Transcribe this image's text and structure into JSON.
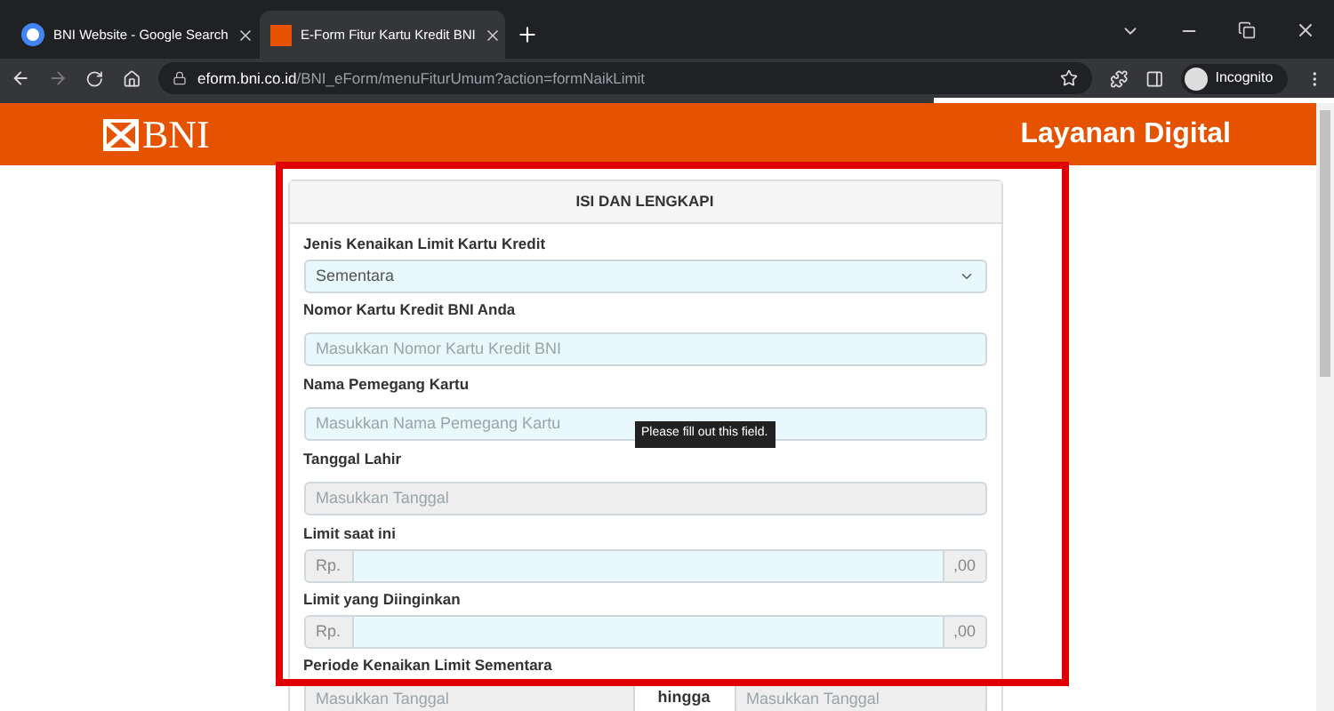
{
  "browser": {
    "tabs": [
      {
        "title": "BNI Website - Google Search",
        "selected": false
      },
      {
        "title": "E-Form Fitur Kartu Kredit BNI",
        "selected": true
      }
    ],
    "url_host": "eform.bni.co.id",
    "url_path": "/BNI_eForm/menuFiturUmum?action=formNaikLimit",
    "profile": "Incognito"
  },
  "header": {
    "logo": "BNI",
    "title": "Layanan Digital"
  },
  "form": {
    "title": "ISI DAN LENGKAPI",
    "fields": [
      {
        "kind": "select",
        "label": "Jenis Kenaikan Limit Kartu Kredit",
        "value": "Sementara"
      },
      {
        "kind": "text",
        "label": "Nomor Kartu Kredit BNI Anda",
        "placeholder": "Masukkan Nomor Kartu Kredit BNI",
        "disabled": false
      },
      {
        "kind": "text",
        "label": "Nama Pemegang Kartu",
        "placeholder": "Masukkan Nama Pemegang Kartu",
        "disabled": false,
        "tooltip": "Please fill out this field."
      },
      {
        "kind": "text",
        "label": "Tanggal Lahir",
        "placeholder": "Masukkan Tanggal",
        "disabled": true
      },
      {
        "kind": "currency",
        "label": "Limit saat ini",
        "prefix": "Rp.",
        "suffix": ",00"
      },
      {
        "kind": "currency",
        "label": "Limit yang Diinginkan",
        "prefix": "Rp.",
        "suffix": ",00"
      },
      {
        "kind": "range",
        "label": "Periode Kenaikan Limit Sementara",
        "from_placeholder": "Masukkan Tanggal",
        "separator": "hingga",
        "to_placeholder": "Masukkan Tanggal"
      }
    ]
  },
  "highlight": true
}
